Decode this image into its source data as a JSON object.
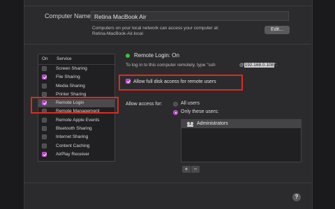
{
  "computer_name": {
    "label": "Computer Name:",
    "value": "Retina MacBook Air",
    "description_line1": "Computers on your local network can access your computer at:",
    "description_line2": "Retina-MacBook-Air.local",
    "edit_label": "Edit..."
  },
  "services": {
    "header_on": "On",
    "header_service": "Service",
    "items": [
      {
        "label": "Screen Sharing",
        "checked": false
      },
      {
        "label": "File Sharing",
        "checked": true
      },
      {
        "label": "Media Sharing",
        "checked": false
      },
      {
        "label": "Printer Sharing",
        "checked": false
      },
      {
        "label": "Remote Login",
        "checked": true,
        "selected": true
      },
      {
        "label": "Remote Management",
        "checked": false
      },
      {
        "label": "Remote Apple Events",
        "checked": false
      },
      {
        "label": "Bluetooth Sharing",
        "checked": false
      },
      {
        "label": "Internet Sharing",
        "checked": false
      },
      {
        "label": "Content Caching",
        "checked": false
      },
      {
        "label": "AirPlay Receiver",
        "checked": true
      }
    ]
  },
  "remote_login": {
    "status": "Remote Login: On",
    "hint": "To log in to this computer remotely, type \"ssh",
    "ip_prefix": "@",
    "ip": "192.168.0.108",
    "ip_suffix": "\".",
    "full_disk_label": "Allow full disk access for remote users",
    "access_label": "Allow access for:",
    "all_users": "All users",
    "only_users": "Only these users:",
    "users": [
      "Administrators"
    ],
    "plus": "+",
    "minus": "−"
  },
  "help_label": "?",
  "colors": {
    "accent": "#b13bc6",
    "highlight_box": "#e02a1b",
    "status_on": "#39c23f"
  }
}
